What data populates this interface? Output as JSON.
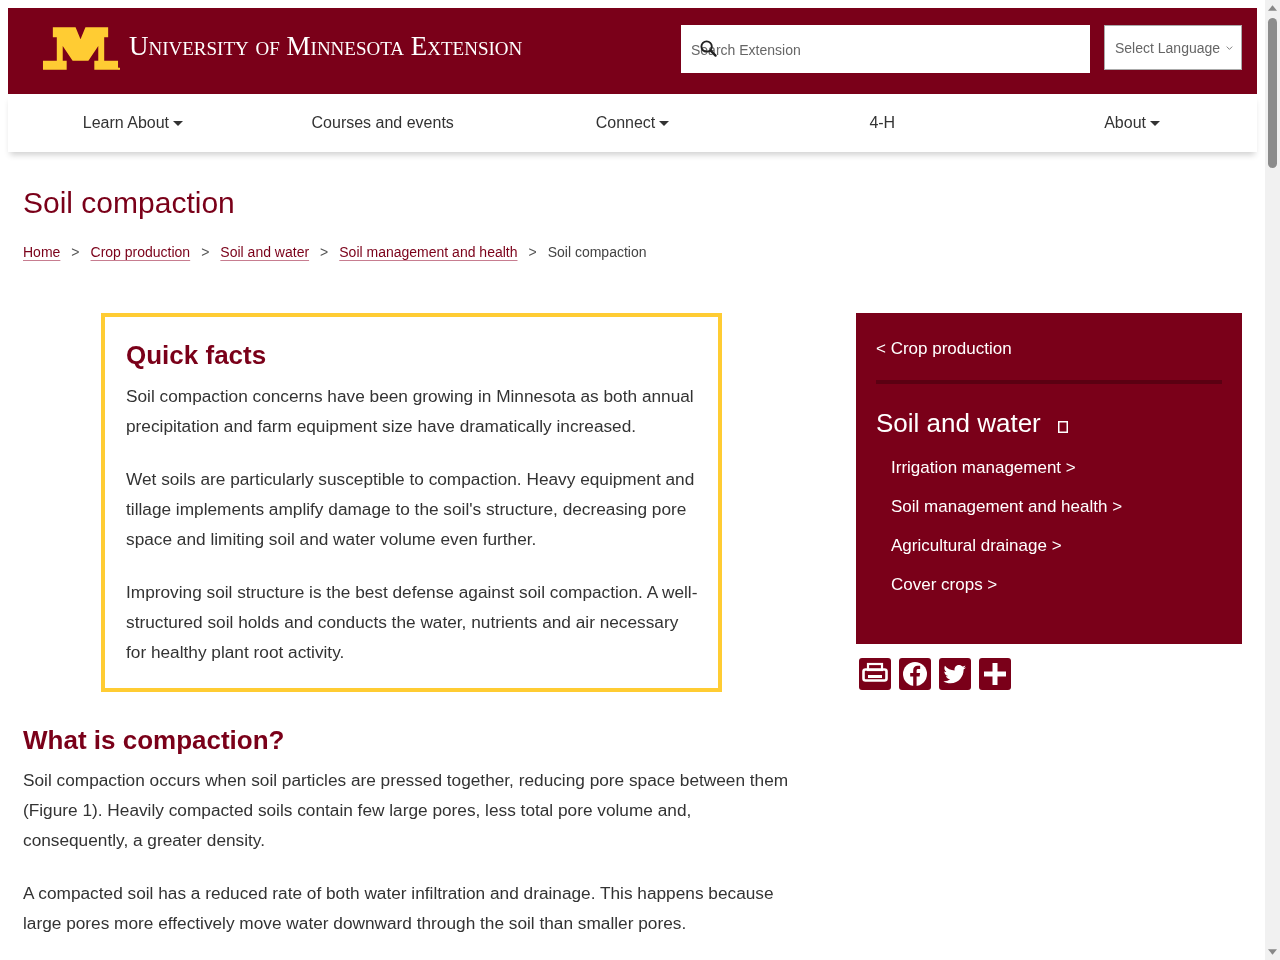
{
  "header": {
    "logo_text": "University of Minnesota Extension",
    "search": {
      "placeholder": "Search Extension"
    },
    "language_select": {
      "value": "Select Language"
    }
  },
  "nav": [
    {
      "label": "Learn About",
      "has_menu": true
    },
    {
      "label": "Courses and events",
      "has_menu": false
    },
    {
      "label": "Connect",
      "has_menu": true
    },
    {
      "label": "4-H",
      "has_menu": false
    },
    {
      "label": "About",
      "has_menu": true
    }
  ],
  "page_title": "Soil compaction",
  "breadcrumbs": [
    {
      "label": "Home",
      "kind": "link"
    },
    {
      "separator": ">",
      "label": "Crop production",
      "kind": "link"
    },
    {
      "separator": ">",
      "label": "Soil and water",
      "kind": "link"
    },
    {
      "separator": ">",
      "label": "Soil management and health",
      "kind": "link"
    },
    {
      "separator": ">",
      "label": "Soil compaction",
      "kind": "current"
    }
  ],
  "quick_facts": {
    "heading": "Quick facts",
    "paragraphs": [
      "Soil compaction concerns have been growing in Minnesota as both annual precipitation and farm equipment size have dramatically increased.",
      "Wet soils are particularly susceptible to compaction. Heavy equipment and tillage implements amplify damage to the soil's structure, decreasing pore space and limiting soil and water volume even further.",
      "Improving soil structure is the best defense against soil compaction. A well-structured soil holds and conducts the water, nutrients and air necessary for healthy plant root activity."
    ]
  },
  "article": {
    "sections": [
      {
        "heading": "What is compaction?",
        "paragraphs": [
          "Soil compaction occurs when soil particles are pressed together, reducing pore space between them (Figure 1). Heavily compacted soils contain few large pores, less total pore volume and, consequently, a greater density.",
          "A compacted soil has a reduced rate of both water infiltration and drainage. This happens because large pores more effectively move water downward through the soil than smaller pores."
        ]
      }
    ]
  },
  "sidebar": {
    "back_link": "< Crop production",
    "heading": "Soil and water",
    "items": [
      "Irrigation management >",
      "Soil management and health >",
      "Agricultural drainage >",
      "Cover crops >"
    ]
  }
}
